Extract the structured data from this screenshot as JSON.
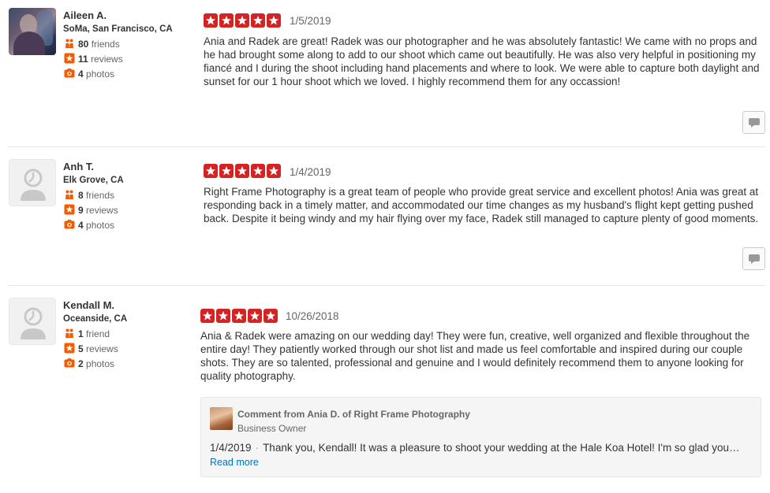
{
  "colors": {
    "star_red": "#d32323",
    "stat_orange": "#f15c00",
    "link_blue": "#0073bb"
  },
  "reviews": [
    {
      "user": {
        "name": "Aileen A.",
        "location": "SoMa, San Francisco, CA",
        "avatar": "user-photo"
      },
      "stats": {
        "friends_count": "80",
        "friends_label": "friends",
        "reviews_count": "11",
        "reviews_label": "reviews",
        "photos_count": "4",
        "photos_label": "photos"
      },
      "rating": 5,
      "date": "1/5/2019",
      "text": "Ania and Radek are great! Radek was our photographer and he was absolutely fantastic! We came with no props and he had brought some along to add to our shoot which came out beautifully. He was also very helpful in positioning my fiancé and I during the shoot including hand placements and where to look. We were able to capture both daylight and sunset for our 1 hour shoot which we loved. I highly recommend them for any occassion!"
    },
    {
      "user": {
        "name": "Anh T.",
        "location": "Elk Grove, CA",
        "avatar": "default-avatar"
      },
      "stats": {
        "friends_count": "8",
        "friends_label": "friends",
        "reviews_count": "9",
        "reviews_label": "reviews",
        "photos_count": "4",
        "photos_label": "photos"
      },
      "rating": 5,
      "date": "1/4/2019",
      "text": "Right Frame Photography is a great team of people who provide great service and excellent photos! Ania was great at responding back in a timely matter, and accommodated our time changes as my husband's flight kept getting pushed back. Despite it being windy and my hair flying over my face, Radek still managed to capture plenty of good  moments."
    },
    {
      "user": {
        "name": "Kendall M.",
        "location": "Oceanside, CA",
        "avatar": "default-avatar"
      },
      "stats": {
        "friends_count": "1",
        "friends_label": "friend",
        "reviews_count": "5",
        "reviews_label": "reviews",
        "photos_count": "2",
        "photos_label": "photos"
      },
      "rating": 5,
      "date": "10/26/2018",
      "text": "Ania & Radek were amazing on our wedding day! They were fun, creative, well organized and flexible throughout the entire day! They patiently worked through our shot list and made us feel comfortable and inspired during our couple shots. They are so talented, professional and genuine and I would definitely recommend them to anyone looking for quality photography.",
      "owner_comment": {
        "title": "Comment from Ania D. of Right Frame Photography",
        "role": "Business Owner",
        "date": "1/4/2019",
        "separator": "·",
        "text": "Thank you, Kendall! It was a pleasure to shoot your wedding at the Hale Koa Hotel! I'm so glad you…",
        "read_more": "Read more"
      }
    }
  ],
  "icons": {
    "friends": "friends-icon",
    "reviews": "star-icon",
    "photos": "camera-icon",
    "comment": "speech-bubble-icon",
    "rating_star": "star-icon"
  }
}
